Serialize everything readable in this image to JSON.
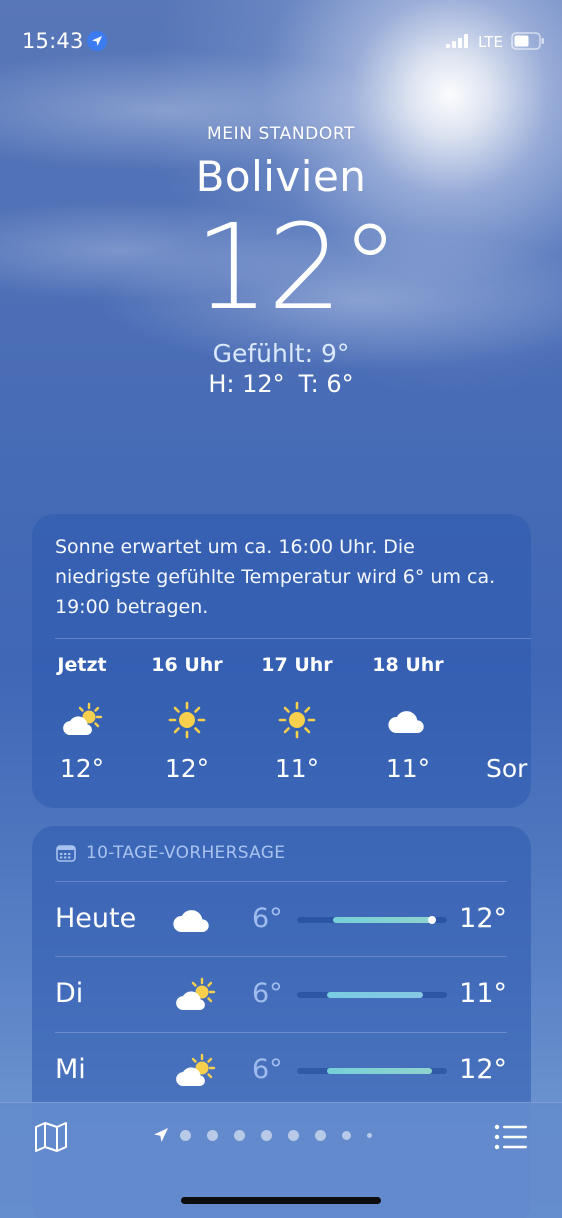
{
  "status_bar": {
    "time": "15:43",
    "network": "LTE",
    "icons": [
      "location-arrow-icon",
      "signal-icon",
      "battery-icon"
    ]
  },
  "header": {
    "location_label": "MEIN STANDORT",
    "city": "Bolivien",
    "temperature": "12°",
    "feels_like": "Gefühlt: 9°",
    "high": "H: 12°",
    "low": "T: 6°"
  },
  "hourly": {
    "summary": "Sonne erwartet um ca. 16:00 Uhr. Die niedrigste gefühlte Temperatur wird 6° um ca. 19:00 betragen.",
    "items": [
      {
        "label": "Jetzt",
        "icon": "partly-sunny-icon",
        "temp": "12°"
      },
      {
        "label": "16 Uhr",
        "icon": "sun-icon",
        "temp": "12°"
      },
      {
        "label": "17 Uhr",
        "icon": "sun-icon",
        "temp": "11°"
      },
      {
        "label": "18 Uhr",
        "icon": "cloud-icon",
        "temp": "11°"
      },
      {
        "label": "",
        "icon": "",
        "temp": "Sor"
      }
    ]
  },
  "forecast": {
    "header": "10-TAGE-VORHERSAGE",
    "header_icon": "calendar-icon",
    "days": [
      {
        "day": "Heute",
        "icon": "cloud-icon",
        "low": "6°",
        "high": "12°",
        "range_start": 0.24,
        "range_end": 0.9,
        "current": 0.9,
        "colors": [
          "#76d0d6",
          "#8fd3cf"
        ]
      },
      {
        "day": "Di",
        "icon": "partly-sunny-icon",
        "low": "6°",
        "high": "11°",
        "range_start": 0.2,
        "range_end": 0.84,
        "current": null,
        "colors": [
          "#79cde2",
          "#86c8e4"
        ]
      },
      {
        "day": "Mi",
        "icon": "partly-sunny-icon",
        "low": "6°",
        "high": "12°",
        "range_start": 0.2,
        "range_end": 0.9,
        "current": null,
        "colors": [
          "#76d0d6",
          "#8fd3cf"
        ]
      }
    ]
  },
  "toolbar": {
    "map_icon": "map-icon",
    "list_icon": "list-icon",
    "page_indicator": {
      "current": "location-arrow-icon",
      "dots": 8
    }
  }
}
